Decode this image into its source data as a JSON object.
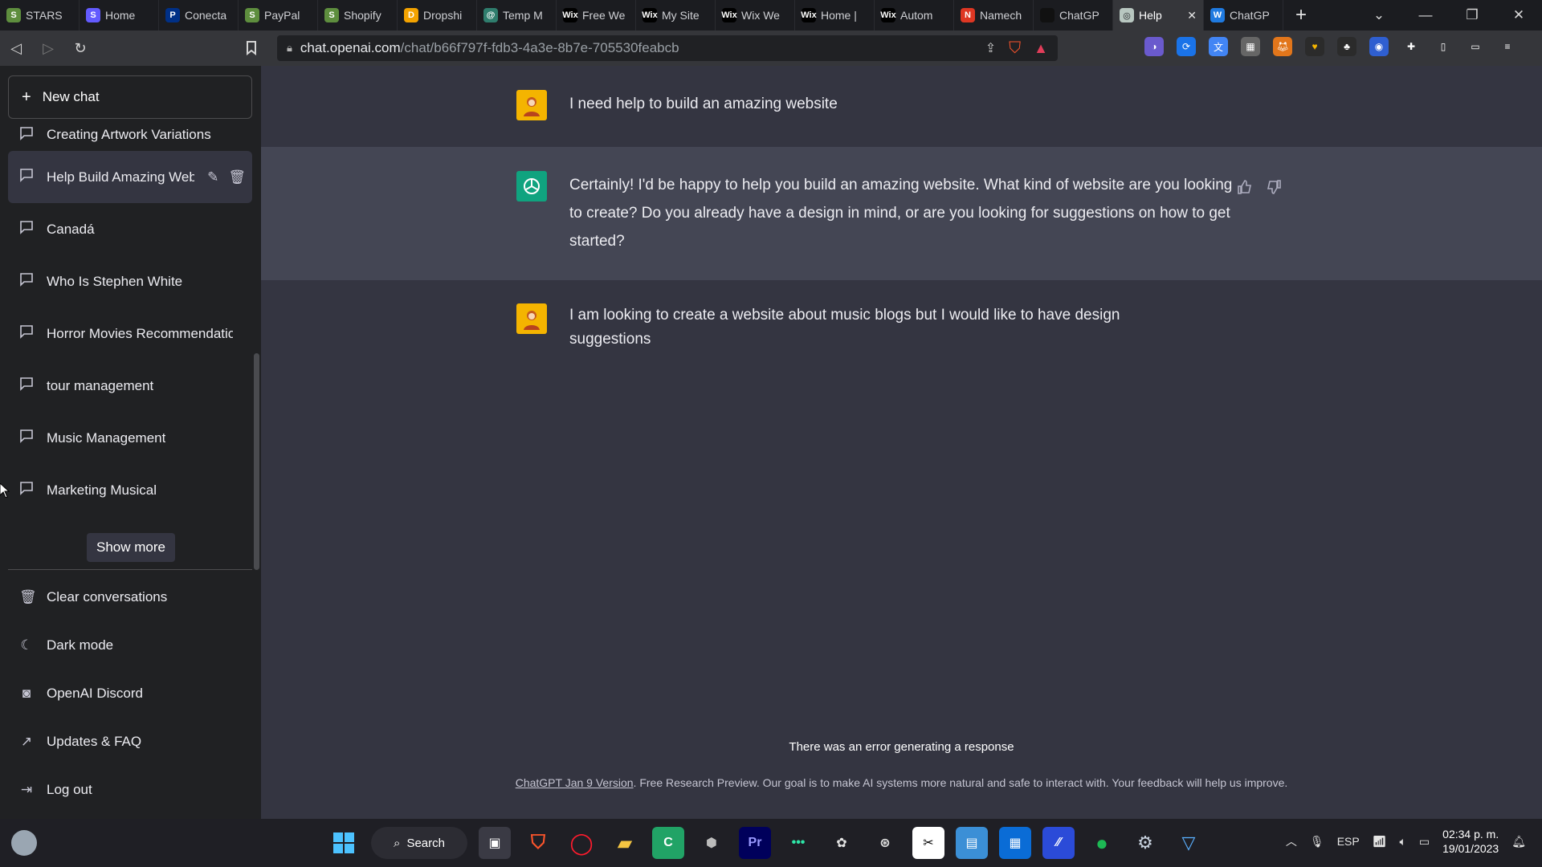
{
  "browser": {
    "tabs": [
      {
        "label": "STARS",
        "icon": "shopify-icon",
        "color": "#5e8e3e",
        "glyph": "S"
      },
      {
        "label": "Home",
        "icon": "stripe-icon",
        "color": "#635bff",
        "glyph": "S"
      },
      {
        "label": "Conecta",
        "icon": "paypal-icon",
        "color": "#003087",
        "glyph": "P"
      },
      {
        "label": "PayPal",
        "icon": "shopify-icon",
        "color": "#5e8e3e",
        "glyph": "S"
      },
      {
        "label": "Shopify",
        "icon": "shopify-icon",
        "color": "#5e8e3e",
        "glyph": "S"
      },
      {
        "label": "Dropshi",
        "icon": "dropshipping-icon",
        "color": "#f4a300",
        "glyph": "D"
      },
      {
        "label": "Temp M",
        "icon": "globe-icon",
        "color": "#2f7d6d",
        "glyph": "@"
      },
      {
        "label": "Free We",
        "icon": "wix-icon",
        "color": "#000000",
        "glyph": "Wix"
      },
      {
        "label": "My Site",
        "icon": "wix-icon",
        "color": "#000000",
        "glyph": "Wix"
      },
      {
        "label": "Wix We",
        "icon": "wix-icon",
        "color": "#000000",
        "glyph": "Wix"
      },
      {
        "label": "Home |",
        "icon": "wix-icon",
        "color": "#000000",
        "glyph": "Wix"
      },
      {
        "label": "Autom",
        "icon": "wix-icon",
        "color": "#000000",
        "glyph": "Wix"
      },
      {
        "label": "Namech",
        "icon": "namecheap-icon",
        "color": "#de3723",
        "glyph": "N"
      },
      {
        "label": "ChatGP",
        "icon": "openai-icon",
        "color": "#111111",
        "glyph": ""
      }
    ],
    "active_tab": {
      "label": "Help",
      "close": "✕"
    },
    "last_tab": {
      "label": "ChatGP",
      "glyph": "W"
    },
    "new_tab": "+",
    "url_host": "chat.openai.com",
    "url_path": "/chat/b66f797f-fdb3-4a3e-8b7e-705530feabcb"
  },
  "sidebar": {
    "new_chat": "New chat",
    "conversations": [
      {
        "label": "Creating Artwork Variations"
      },
      {
        "label": "Help Build Amazing Website"
      },
      {
        "label": "Canadá"
      },
      {
        "label": "Who Is Stephen White"
      },
      {
        "label": "Horror Movies Recommendations"
      },
      {
        "label": "tour management"
      },
      {
        "label": "Music Management"
      },
      {
        "label": "Marketing Musical"
      }
    ],
    "show_more": "Show more",
    "bottom": [
      {
        "label": "Clear conversations",
        "icon": "trash-icon"
      },
      {
        "label": "Dark mode",
        "icon": "moon-icon"
      },
      {
        "label": "OpenAI Discord",
        "icon": "discord-icon"
      },
      {
        "label": "Updates & FAQ",
        "icon": "external-link-icon"
      },
      {
        "label": "Log out",
        "icon": "logout-icon"
      }
    ]
  },
  "chat": {
    "messages": [
      {
        "role": "user",
        "text": "I need help to build an amazing website"
      },
      {
        "role": "assistant",
        "text": "Certainly! I'd be happy to help you build an amazing website. What kind of website are you looking to create? Do you already have a design in mind, or are you looking for suggestions on how to get started?"
      },
      {
        "role": "user",
        "text": "I am looking to create a website about music blogs but I would like to have design suggestions"
      }
    ],
    "error": "There was an error generating a response",
    "footer_link": "ChatGPT Jan 9 Version",
    "footer_text": ". Free Research Preview. Our goal is to make AI systems more natural and safe to interact with. Your feedback will help us improve."
  },
  "taskbar": {
    "search_label": "Search",
    "language": "ESP",
    "time": "02:34 p. m.",
    "date": "19/01/2023"
  },
  "colors": {
    "sidebar_bg": "#202123",
    "chat_bg": "#343541",
    "assistant_bg": "#444654",
    "openai_green": "#10a37f",
    "user_avatar": "#f4b400"
  }
}
